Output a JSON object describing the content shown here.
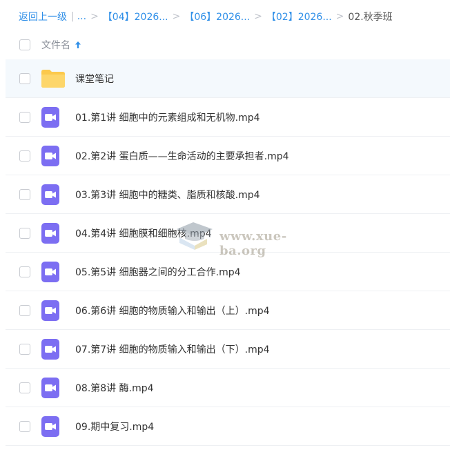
{
  "breadcrumb": {
    "back": "返回上一级",
    "separator_bar": "|",
    "ellipsis": "...",
    "items": [
      "【04】2026...",
      "【06】2026...",
      "【02】2026..."
    ],
    "current": "02.秋季班"
  },
  "header": {
    "column_name": "文件名"
  },
  "files": [
    {
      "name": "课堂笔记",
      "type": "folder"
    },
    {
      "name": "01.第1讲 细胞中的元素组成和无机物.mp4",
      "type": "video"
    },
    {
      "name": "02.第2讲 蛋白质——生命活动的主要承担者.mp4",
      "type": "video"
    },
    {
      "name": "03.第3讲 细胞中的糖类、脂质和核酸.mp4",
      "type": "video"
    },
    {
      "name": "04.第4讲 细胞膜和细胞核.mp4",
      "type": "video"
    },
    {
      "name": "05.第5讲 细胞器之间的分工合作.mp4",
      "type": "video"
    },
    {
      "name": "06.第6讲 细胞的物质输入和输出（上）.mp4",
      "type": "video"
    },
    {
      "name": "07.第7讲 细胞的物质输入和输出（下）.mp4",
      "type": "video"
    },
    {
      "name": "08.第8讲 酶.mp4",
      "type": "video"
    },
    {
      "name": "09.期中复习.mp4",
      "type": "video"
    }
  ],
  "watermark": {
    "text": "www.xue-ba.org"
  },
  "colors": {
    "link": "#2f8fe8",
    "folder": "#fcc94c",
    "video": "#7c6ef2",
    "row_highlight": "#f4f9fd"
  }
}
